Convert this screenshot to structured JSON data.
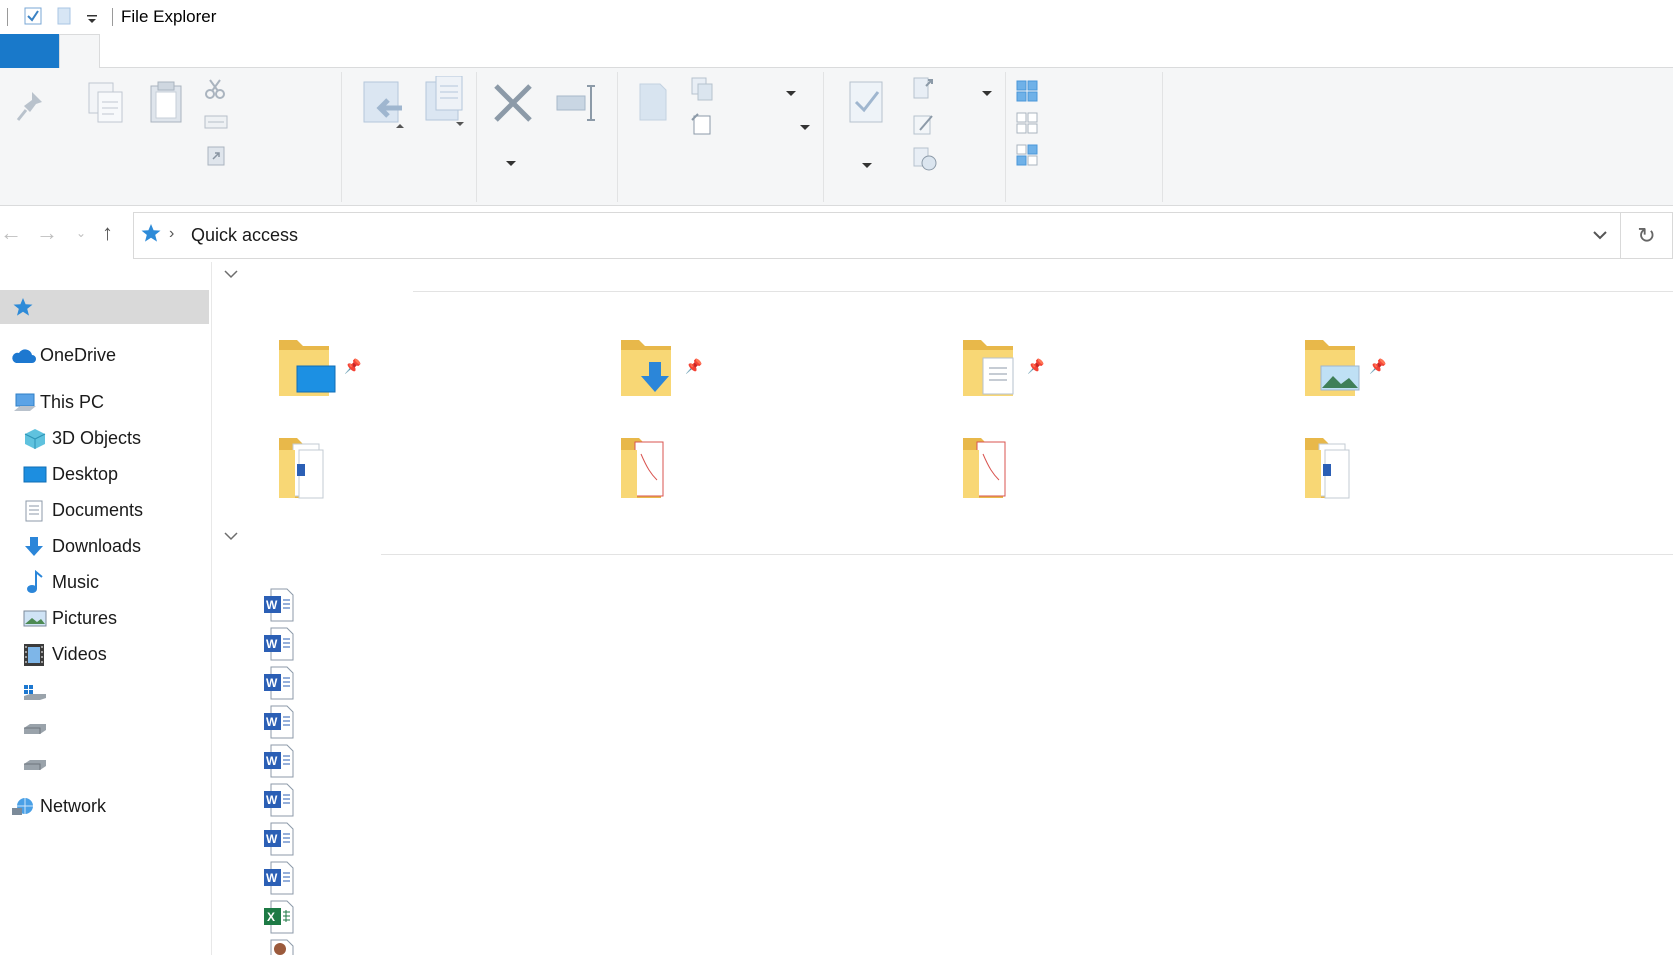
{
  "window": {
    "title": "File Explorer"
  },
  "address_bar": {
    "location": "Quick access"
  },
  "sidebar": {
    "items": [
      {
        "label": "OneDrive",
        "icon": "onedrive-cloud-icon"
      },
      {
        "label": "This PC",
        "icon": "computer-icon"
      },
      {
        "label": "3D Objects",
        "icon": "3d-objects-icon"
      },
      {
        "label": "Desktop",
        "icon": "desktop-icon"
      },
      {
        "label": "Documents",
        "icon": "documents-icon"
      },
      {
        "label": "Downloads",
        "icon": "downloads-icon"
      },
      {
        "label": "Music",
        "icon": "music-icon"
      },
      {
        "label": "Pictures",
        "icon": "pictures-icon"
      },
      {
        "label": "Videos",
        "icon": "videos-icon"
      },
      {
        "label": "Network",
        "icon": "network-icon"
      }
    ]
  },
  "colors": {
    "accent": "#1979ca",
    "folder": "#f8d775",
    "ribbon_bg": "#f5f6f7",
    "selected": "#d9d9d9"
  }
}
